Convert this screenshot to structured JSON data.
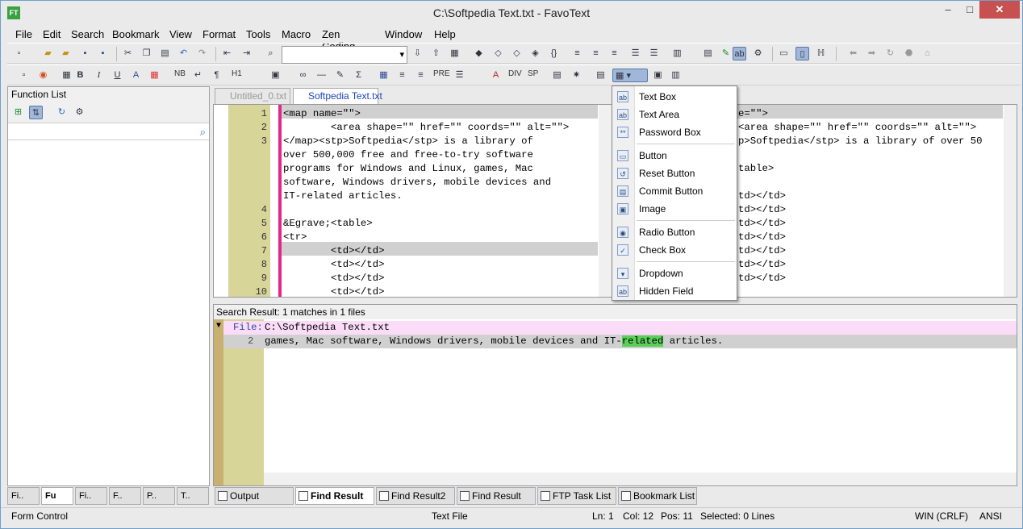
{
  "window": {
    "title": "C:\\Softpedia Text.txt - FavoText",
    "app_icon": "FT",
    "minimize_glyph": "–",
    "maximize_glyph": "□",
    "close_glyph": "✕"
  },
  "menu": [
    "File",
    "Edit",
    "Search",
    "Bookmark",
    "View",
    "Format",
    "Tools",
    "Macro",
    "Zen Coding",
    "Window",
    "Help"
  ],
  "toolbar2_text": {
    "nb": "NB",
    "h1": "H1",
    "pre": "PRE",
    "div": "DIV",
    "sp": "SP"
  },
  "function_list": {
    "title": "Function List",
    "search_value": ""
  },
  "left_tabs": [
    "Fi..",
    "Fu",
    "Fi..",
    "F..",
    "P..",
    "T.."
  ],
  "doc_tabs": {
    "untitled": "Untitled_0.txt",
    "active": "Softpedia Text.txt"
  },
  "editor_lines": [
    {
      "n": "1",
      "text": "<map name=\"\">"
    },
    {
      "n": "2",
      "text": "        <area shape=\"\" href=\"\" coords=\"\" alt=\"\">"
    },
    {
      "n": "3",
      "text": "</map><stp>Softpedia</stp> is a library of"
    },
    {
      "n": "",
      "text": "over 500,000 free and free-to-try software"
    },
    {
      "n": "",
      "text": "programs for Windows and Linux, games, Mac"
    },
    {
      "n": "",
      "text": "software, Windows drivers, mobile devices and"
    },
    {
      "n": "",
      "text": "IT-related articles."
    },
    {
      "n": "4",
      "text": ""
    },
    {
      "n": "5",
      "text": "&Egrave;<table>"
    },
    {
      "n": "6",
      "text": "<tr>"
    },
    {
      "n": "7",
      "text": "        <td></td>"
    },
    {
      "n": "8",
      "text": "        <td></td>"
    },
    {
      "n": "9",
      "text": "        <td></td>"
    },
    {
      "n": "10",
      "text": "        <td></td>"
    }
  ],
  "editor2_lines": [
    "e=\"\">",
    "<area shape=\"\" href=\"\" coords=\"\" alt=\"\">",
    "p>Softpedia</stp> is a library of over 50",
    "",
    "table>",
    "",
    "td></td>",
    "td></td>",
    "td></td>",
    "td></td>",
    "td></td>",
    "td></td>",
    "td></td>"
  ],
  "form_menu": [
    {
      "label": "Text Box",
      "icon": "textbox-icon",
      "glyph": "ab"
    },
    {
      "label": "Text Area",
      "icon": "textarea-icon",
      "glyph": "ab"
    },
    {
      "label": "Password Box",
      "icon": "password-icon",
      "glyph": "**"
    },
    {
      "label": "Button",
      "icon": "button-icon",
      "glyph": "▭"
    },
    {
      "label": "Reset Button",
      "icon": "reset-button-icon",
      "glyph": "↺"
    },
    {
      "label": "Commit Button",
      "icon": "commit-button-icon",
      "glyph": "▤"
    },
    {
      "label": "Image",
      "icon": "image-icon",
      "glyph": "▣"
    },
    {
      "label": "Radio Button",
      "icon": "radio-icon",
      "glyph": "◉"
    },
    {
      "label": "Check Box",
      "icon": "checkbox-icon",
      "glyph": "✓"
    },
    {
      "label": "Dropdown",
      "icon": "dropdown-icon",
      "glyph": "▾"
    },
    {
      "label": "Hidden Field",
      "icon": "hidden-field-icon",
      "glyph": "ab"
    }
  ],
  "search": {
    "title": "Search Result: 1 matches in 1 files",
    "file_label": "File:",
    "file_path": "C:\\Softpedia Text.txt",
    "line_no": "2",
    "line_pre": "games, Mac software, Windows drivers, mobile devices and IT-",
    "line_match": "related",
    "line_post": " articles.",
    "fold_glyph": "▼"
  },
  "bottom_tabs": [
    "Output",
    "Find Result",
    "Find Result2",
    "Find Result",
    "FTP Task List",
    "Bookmark List"
  ],
  "status": {
    "left": "Form Control",
    "type": "Text File",
    "ln": "Ln: 1",
    "col": "Col: 12",
    "pos": "Pos: 11",
    "selected": "Selected: 0 Lines",
    "eol": "WIN (CRLF)",
    "enc": "ANSI"
  },
  "colors": {
    "gutter": "#d8d598",
    "change_bar": "#e0288a",
    "match": "#5acf5a",
    "file_row": "#fadcf8"
  }
}
